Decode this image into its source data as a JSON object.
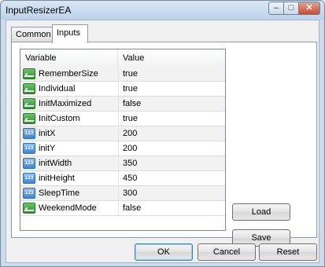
{
  "window": {
    "title": "InputResizerEA",
    "min_glyph": "–",
    "max_glyph": "□",
    "close_glyph": "✕"
  },
  "tabs": [
    {
      "label": "Common"
    },
    {
      "label": "Inputs"
    }
  ],
  "table": {
    "columns": [
      "Variable",
      "Value"
    ],
    "rows": [
      {
        "type": "bool",
        "name": "RememberSize",
        "value": "true"
      },
      {
        "type": "bool",
        "name": "Individual",
        "value": "true"
      },
      {
        "type": "bool",
        "name": "InitMaximized",
        "value": "false"
      },
      {
        "type": "bool",
        "name": "InitCustom",
        "value": "true"
      },
      {
        "type": "num",
        "name": "initX",
        "value": "200"
      },
      {
        "type": "num",
        "name": "initY",
        "value": "200"
      },
      {
        "type": "num",
        "name": "initWidth",
        "value": "350"
      },
      {
        "type": "num",
        "name": "initHeight",
        "value": "450"
      },
      {
        "type": "num",
        "name": "SleepTime",
        "value": "300"
      },
      {
        "type": "bool",
        "name": "WeekendMode",
        "value": "false"
      }
    ],
    "num_icon_text": "123"
  },
  "buttons": {
    "load": "Load",
    "save": "Save",
    "ok": "OK",
    "cancel": "Cancel",
    "reset": "Reset"
  }
}
